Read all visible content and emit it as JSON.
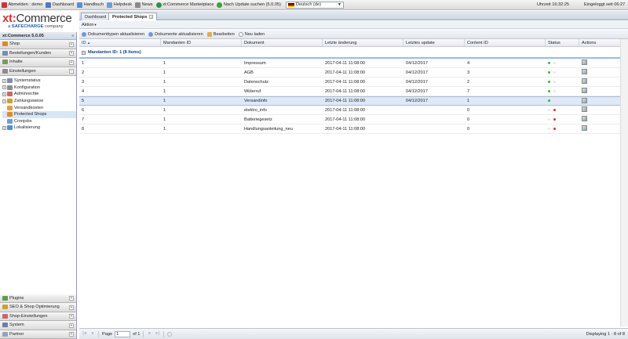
{
  "topbar": {
    "logout": "Abmelden : demo",
    "dashboard": "Dashboard",
    "handbook": "Handbuch",
    "helpdesk": "Helpdesk",
    "news": "News",
    "marketplace": "xt:Commerce Marketplace",
    "update": "Nach Update suchen (5.0.05)",
    "language": "Deutsch (de)",
    "clock": "Uhrzeit 16:32:25",
    "logged_in": "Eingeloggt seit 06:27"
  },
  "logo": {
    "brand_prefix": "xt:",
    "brand_name": "Commerce",
    "tagline_a": "a",
    "tagline_brand": "SAFECHARGE",
    "tagline_rest": "company"
  },
  "sidebar": {
    "version": "xt:Commerce 5.0.05",
    "sections": [
      "Shop",
      "Bestellungen/Kunden",
      "Inhalte",
      "Einstellungen"
    ],
    "tree": [
      {
        "label": "Systemstatus",
        "exp": "+"
      },
      {
        "label": "Konfiguration",
        "exp": "+"
      },
      {
        "label": "Adminrechte",
        "exp": "+"
      },
      {
        "label": "Zahlungsweise",
        "exp": "+"
      },
      {
        "label": "Versandkosten",
        "exp": ""
      },
      {
        "label": "Protected Shops",
        "exp": ""
      },
      {
        "label": "Cronjobs",
        "exp": ""
      },
      {
        "label": "Lokalisierung",
        "exp": "+"
      }
    ],
    "bottom_sections": [
      "Plugins",
      "SEO & Shop Optimierung",
      "Shop-Einstellungen",
      "System",
      "Partner"
    ]
  },
  "tabs": [
    {
      "label": "Dashboard"
    },
    {
      "label": "Protected Shops"
    }
  ],
  "action_menu": "Aktion",
  "toolbar": {
    "update_doctypes": "Dokumenttypen aktualisieren",
    "update_docs": "Dokumente aktualisieren",
    "edit": "Bearbeiten",
    "reload": "Neu laden"
  },
  "grid": {
    "columns": [
      "ID",
      "Mandanten ID",
      "Dokument",
      "Letzte änderung",
      "Letztes update",
      "Content ID",
      "Status",
      "Actions"
    ],
    "sort_indicator": "▲",
    "group_label": "Mandanten ID: 1 (8 Items)",
    "rows": [
      {
        "id": "1",
        "mandant": "1",
        "doc": "Impressum",
        "changed": "2017-04-11 11:08:00",
        "updated": "04/12/2017",
        "content_id": "4",
        "status": "green"
      },
      {
        "id": "2",
        "mandant": "1",
        "doc": "AGB",
        "changed": "2017-04-11 11:08:00",
        "updated": "04/12/2017",
        "content_id": "3",
        "status": "green"
      },
      {
        "id": "3",
        "mandant": "1",
        "doc": "Datenschutz",
        "changed": "2017-04-11 11:08:00",
        "updated": "04/12/2017",
        "content_id": "2",
        "status": "green"
      },
      {
        "id": "4",
        "mandant": "1",
        "doc": "Widerruf",
        "changed": "2017-04-11 11:08:00",
        "updated": "04/12/2017",
        "content_id": "7",
        "status": "green"
      },
      {
        "id": "5",
        "mandant": "1",
        "doc": "Versandinfo",
        "changed": "2017-04-11 11:08:00",
        "updated": "04/12/2017",
        "content_id": "1",
        "status": "green"
      },
      {
        "id": "6",
        "mandant": "1",
        "doc": "elektro_info",
        "changed": "2017-04-11 11:08:00",
        "updated": "",
        "content_id": "0",
        "status": "red"
      },
      {
        "id": "7",
        "mandant": "1",
        "doc": "Batteriegesetz",
        "changed": "2017-04-11 11:08:00",
        "updated": "",
        "content_id": "0",
        "status": "red"
      },
      {
        "id": "8",
        "mandant": "1",
        "doc": "Handlungsanleitung_neu",
        "changed": "2017-04-11 11:08:00",
        "updated": "",
        "content_id": "0",
        "status": "red"
      }
    ],
    "selected_row": 5
  },
  "pager": {
    "page_label": "Page",
    "page_value": "1",
    "of_label": "of 1",
    "info": "Displaying 1 - 8 of 8"
  },
  "colors": {
    "status_green": "#3cb13c",
    "status_red": "#e03030",
    "status_off": "#e8e8e8"
  }
}
